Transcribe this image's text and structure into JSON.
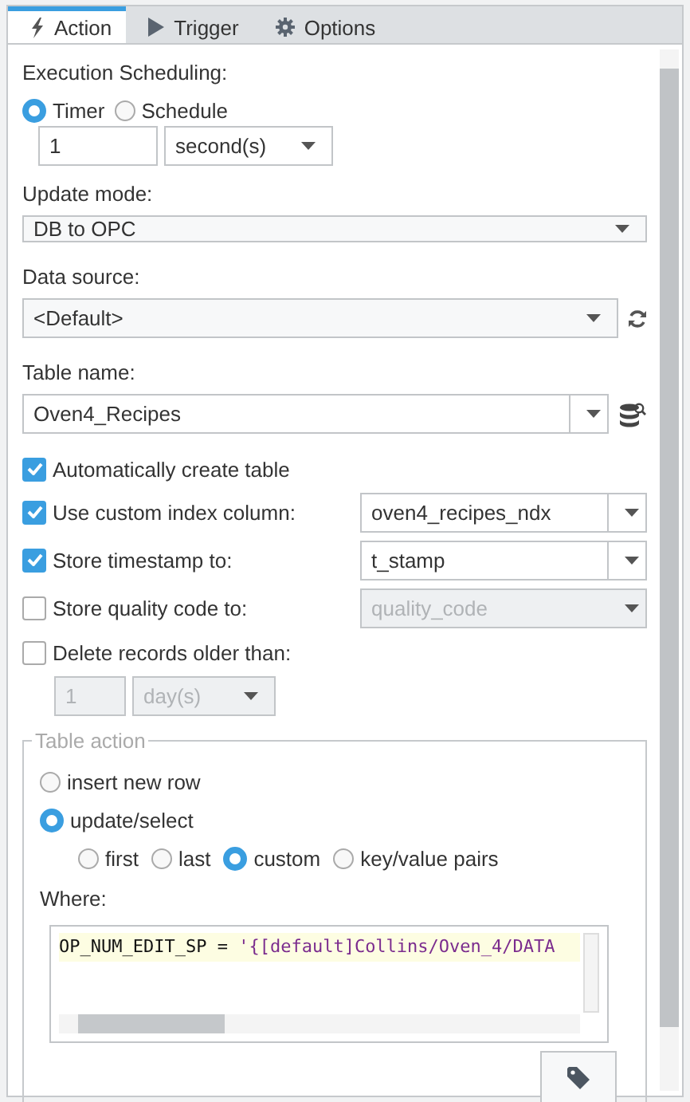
{
  "tabs": [
    {
      "label": "Action",
      "selected": true
    },
    {
      "label": "Trigger",
      "selected": false
    },
    {
      "label": "Options",
      "selected": false
    }
  ],
  "execution_scheduling": {
    "label": "Execution Scheduling:",
    "modes": [
      {
        "label": "Timer",
        "selected": true
      },
      {
        "label": "Schedule",
        "selected": false
      }
    ],
    "rate": "1",
    "unit": "second(s)"
  },
  "update_mode": {
    "label": "Update mode:",
    "value": "DB to OPC"
  },
  "data_source": {
    "label": "Data source:",
    "value": "<Default>"
  },
  "table_name": {
    "label": "Table name:",
    "value": "Oven4_Recipes"
  },
  "options": [
    {
      "label": "Automatically create table",
      "checked": true
    },
    {
      "label": "Use custom index column:",
      "checked": true,
      "value": "oven4_recipes_ndx"
    },
    {
      "label": "Store timestamp to:",
      "checked": true,
      "value": "t_stamp"
    },
    {
      "label": "Store quality code to:",
      "checked": false,
      "value": "quality_code"
    },
    {
      "label": "Delete records older than:",
      "checked": false
    }
  ],
  "delete_age": {
    "value": "1",
    "unit": "day(s)",
    "disabled": true
  },
  "table_action": {
    "legend": "Table action",
    "actions": [
      {
        "label": "insert new row",
        "selected": false
      },
      {
        "label": "update/select",
        "selected": true
      }
    ],
    "select_modes": [
      {
        "label": "first",
        "selected": false
      },
      {
        "label": "last",
        "selected": false
      },
      {
        "label": "custom",
        "selected": true
      },
      {
        "label": "key/value pairs",
        "selected": false
      }
    ],
    "where_label": "Where:",
    "where_code": "OP_NUM_EDIT_SP = '{[default]Collins/Oven_4/DATA"
  }
}
